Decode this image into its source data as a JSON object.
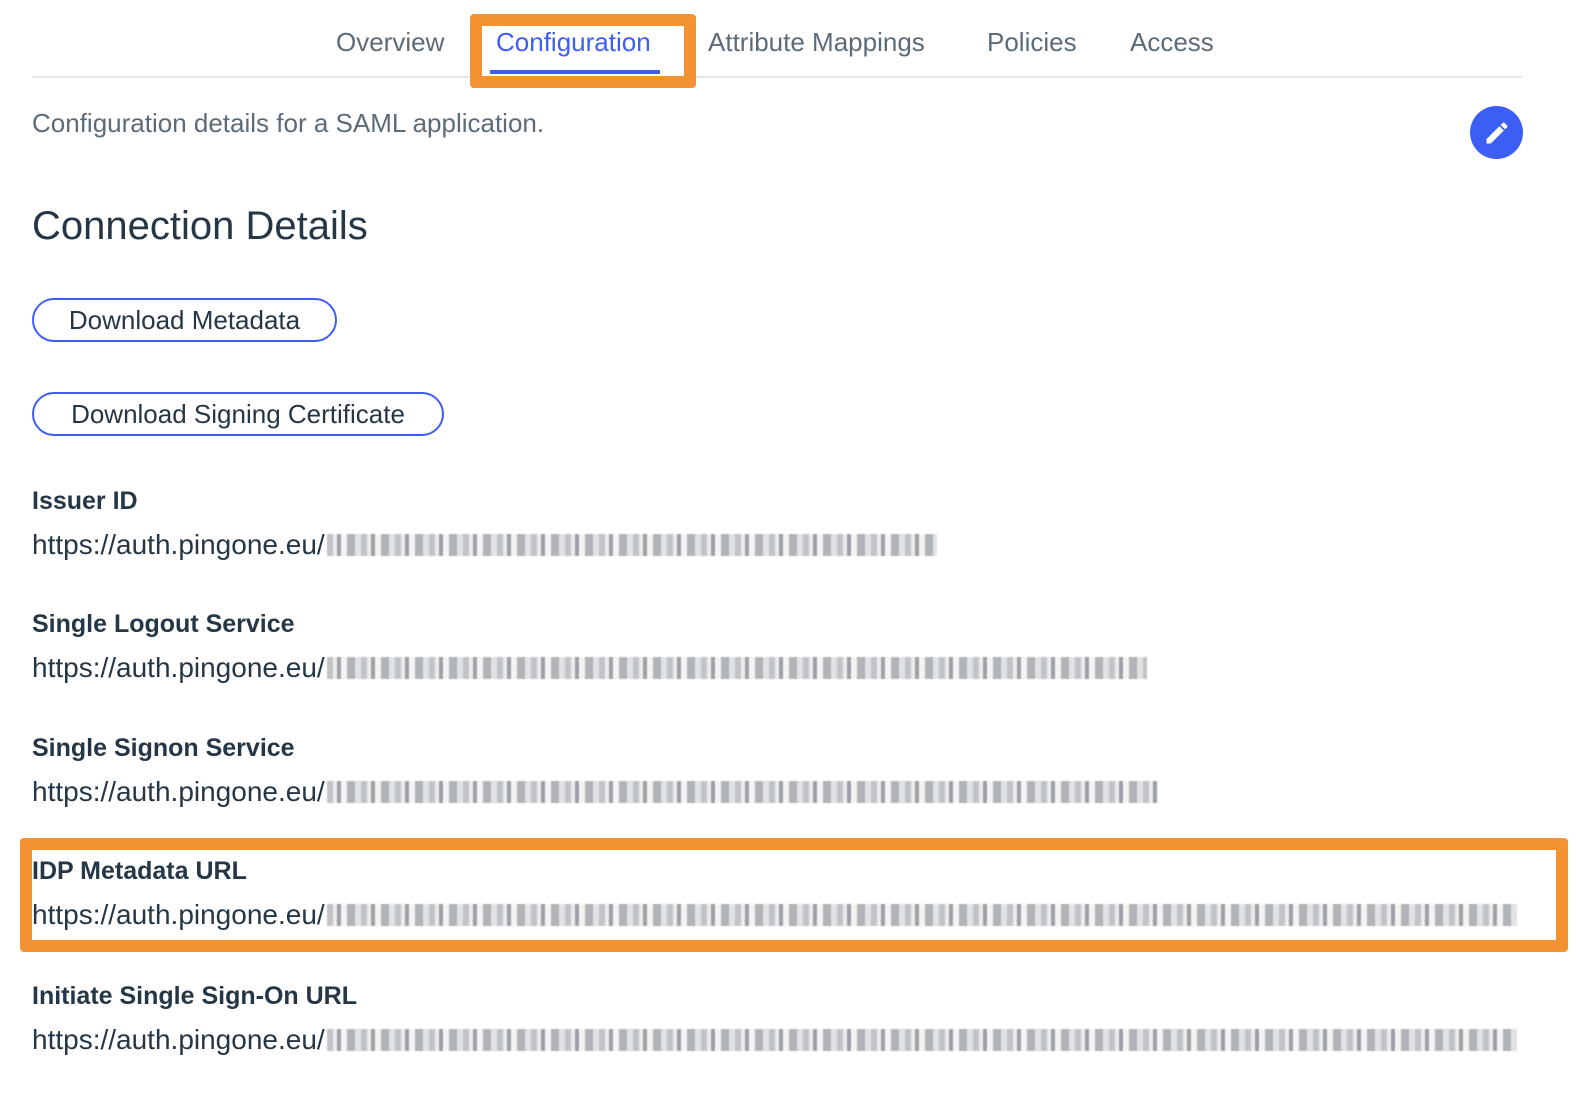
{
  "tabs": [
    {
      "label": "Overview",
      "active": false
    },
    {
      "label": "Configuration",
      "active": true
    },
    {
      "label": "Attribute Mappings",
      "active": false
    },
    {
      "label": "Policies",
      "active": false
    },
    {
      "label": "Access",
      "active": false
    }
  ],
  "description": "Configuration details for a SAML application.",
  "edit_icon": "pencil-icon",
  "section": {
    "title": "Connection Details"
  },
  "buttons": {
    "download_metadata": "Download Metadata",
    "download_signing_certificate": "Download Signing Certificate"
  },
  "details": {
    "issuer_id": {
      "label": "Issuer ID",
      "value_prefix": "https://auth.pingone.eu/"
    },
    "single_logout": {
      "label": "Single Logout Service",
      "value_prefix": "https://auth.pingone.eu/"
    },
    "single_signon": {
      "label": "Single Signon Service",
      "value_prefix": "https://auth.pingone.eu/"
    },
    "idp_metadata_url": {
      "label": "IDP Metadata URL",
      "value_prefix": "https://auth.pingone.eu/"
    },
    "initiate_sso_url": {
      "label": "Initiate Single Sign-On URL",
      "value_prefix": "https://auth.pingone.eu/"
    }
  },
  "colors": {
    "accent": "#3d5ef5",
    "highlight": "#f29233",
    "text": "#253746",
    "muted": "#5c6b78"
  }
}
